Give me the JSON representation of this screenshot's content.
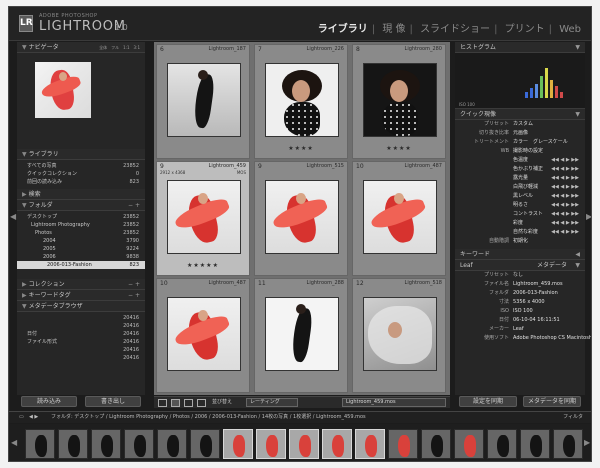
{
  "app": {
    "logo": "LR",
    "brand_top": "ADOBE PHOTOSHOP",
    "brand": "LIGHTROOM",
    "version": "1.0"
  },
  "modules": {
    "library": "ライブラリ",
    "develop": "現 像",
    "slideshow": "スライドショー",
    "print": "プリント",
    "web": "Web"
  },
  "left": {
    "navigator": {
      "title": "ナビゲータ",
      "modes": "全体　フル　1:1　3:1"
    },
    "library": {
      "title": "ライブラリ",
      "items": [
        {
          "label": "すべての写真",
          "count": "23852"
        },
        {
          "label": "クイックコレクション",
          "count": "0"
        },
        {
          "label": "前回の読み込み",
          "count": "823"
        }
      ]
    },
    "find": {
      "title": "検索"
    },
    "folders": {
      "title": "フォルダ",
      "items": [
        {
          "label": "デスクトップ",
          "count": "23852"
        },
        {
          "label": "Lightroom Photography",
          "count": "23852"
        },
        {
          "label": "Photos",
          "count": "23852"
        },
        {
          "label": "2004",
          "count": "3790"
        },
        {
          "label": "2005",
          "count": "9224"
        },
        {
          "label": "2006",
          "count": "9838"
        },
        {
          "label": "2006-013-Fashion",
          "count": "823"
        }
      ]
    },
    "collections": {
      "title": "コレクション"
    },
    "keyword_tags": {
      "title": "キーワードタグ"
    },
    "metadata_browser": {
      "title": "メタデータブラウザ",
      "items": [
        {
          "label": "",
          "count": "20416"
        },
        {
          "label": "",
          "count": "20416"
        },
        {
          "label": "日付",
          "count": "20416"
        },
        {
          "label": "ファイル形式",
          "count": "20416"
        },
        {
          "label": "",
          "count": "20416"
        },
        {
          "label": "",
          "count": "20416"
        }
      ]
    },
    "import_button": "読み込み",
    "export_button": "書き出し"
  },
  "grid": {
    "cells": [
      {
        "num": "6",
        "name": "Lightroom_187",
        "dims": "",
        "ext": "",
        "stars": "",
        "photo": "pose-black"
      },
      {
        "num": "7",
        "name": "Lightroom_226",
        "dims": "",
        "ext": "",
        "stars": "★★★★",
        "photo": "portrait-dots"
      },
      {
        "num": "8",
        "name": "Lightroom_280",
        "dims": "",
        "ext": "",
        "stars": "★★★★",
        "photo": "portrait-dots-2"
      },
      {
        "num": "9",
        "name": "Lightroom_459",
        "dims": "2912 x 4368",
        "ext": "MOS",
        "stars": "★★★★★",
        "photo": "red-fabric"
      },
      {
        "num": "9",
        "name": "Lightroom_515",
        "dims": "",
        "ext": "",
        "stars": "",
        "photo": "red-pose"
      },
      {
        "num": "10",
        "name": "Lightroom_487",
        "dims": "",
        "ext": "",
        "stars": "",
        "photo": "red-lying"
      },
      {
        "num": "10",
        "name": "Lightroom_487",
        "dims": "",
        "ext": "",
        "stars": "",
        "photo": "red-fabric-2"
      },
      {
        "num": "11",
        "name": "Lightroom_288",
        "dims": "",
        "ext": "",
        "stars": "",
        "photo": "dancer-white"
      },
      {
        "num": "12",
        "name": "Lightroom_518",
        "dims": "",
        "ext": "",
        "stars": "",
        "photo": "veil-portrait"
      }
    ]
  },
  "toolbar": {
    "sort_label": "並び替え",
    "sort_value": "レーティング",
    "filter_label": "Lightroom_459.mos"
  },
  "right": {
    "histogram": {
      "title": "ヒストグラム",
      "info": "ISO 100"
    },
    "quick_develop": {
      "title": "クイック現像",
      "rows": [
        {
          "label": "プリセット",
          "value": "カスタム"
        },
        {
          "label": "切り抜き比率",
          "value": "元画像"
        },
        {
          "label": "トリートメント",
          "value": "カラー　グレースケール"
        },
        {
          "label": "WB",
          "value": "撮影時の設定"
        },
        {
          "label": "",
          "value": "色温度"
        },
        {
          "label": "",
          "value": "色かぶり補正"
        },
        {
          "label": "",
          "value": "露光量"
        },
        {
          "label": "",
          "value": "白飛び軽減"
        },
        {
          "label": "",
          "value": "黒レベル"
        },
        {
          "label": "",
          "value": "明るさ"
        },
        {
          "label": "",
          "value": "コントラスト"
        },
        {
          "label": "",
          "value": "彩度"
        },
        {
          "label": "",
          "value": "自然な彩度"
        },
        {
          "label": "自動階調",
          "value": "初期化"
        }
      ]
    },
    "keywords": {
      "title": "キーワード"
    },
    "metadata": {
      "title": "メタデータ",
      "preset": "Leaf",
      "preset_value": "なし",
      "rows": [
        {
          "label": "ファイル名",
          "value": "Lightroom_459.mos"
        },
        {
          "label": "フォルダ",
          "value": "2006-013-Fashion"
        },
        {
          "label": "寸法",
          "value": "5356 x 4000"
        },
        {
          "label": "ISO",
          "value": "ISO 100"
        },
        {
          "label": "日付",
          "value": "06-10-04 16:11:51"
        },
        {
          "label": "メーカー",
          "value": "Leaf"
        },
        {
          "label": "使用ソフト",
          "value": "Adobe Photoshop CS Macintosh"
        }
      ]
    },
    "sync_settings_button": "設定を同期",
    "sync_metadata_button": "メタデータを同期"
  },
  "breadcrumb": {
    "text": "フォルダ: デスクトップ / Lightroom Photography / Photos / 2006 / 2006-013-Fashion / 14枚の写真 / 1枚選択 / Lightroom_459.mos",
    "filter": "フィルタ"
  }
}
